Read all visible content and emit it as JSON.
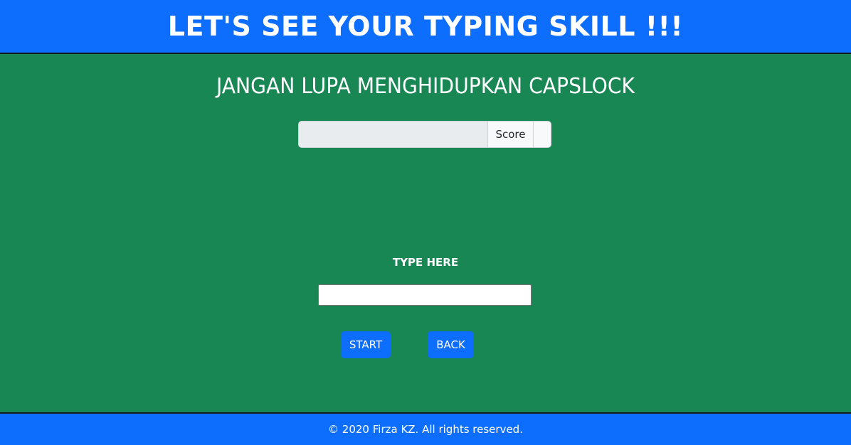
{
  "header": {
    "title": "LET'S SEE YOUR TYPING SKILL !!!"
  },
  "main": {
    "reminder": "JANGAN LUPA MENGHIDUPKAN CAPSLOCK",
    "score": {
      "value": "",
      "label": "Score",
      "extra": ""
    },
    "type_label": "TYPE HERE",
    "type_input": {
      "value": "",
      "placeholder": ""
    },
    "buttons": {
      "start": "START",
      "back": "BACK"
    }
  },
  "footer": {
    "copyright": "© 2020 Firza KZ. All rights reserved."
  },
  "colors": {
    "header_bg": "#0d6efd",
    "page_bg": "#198754",
    "button_bg": "#0d6efd",
    "text": "#ffffff"
  }
}
